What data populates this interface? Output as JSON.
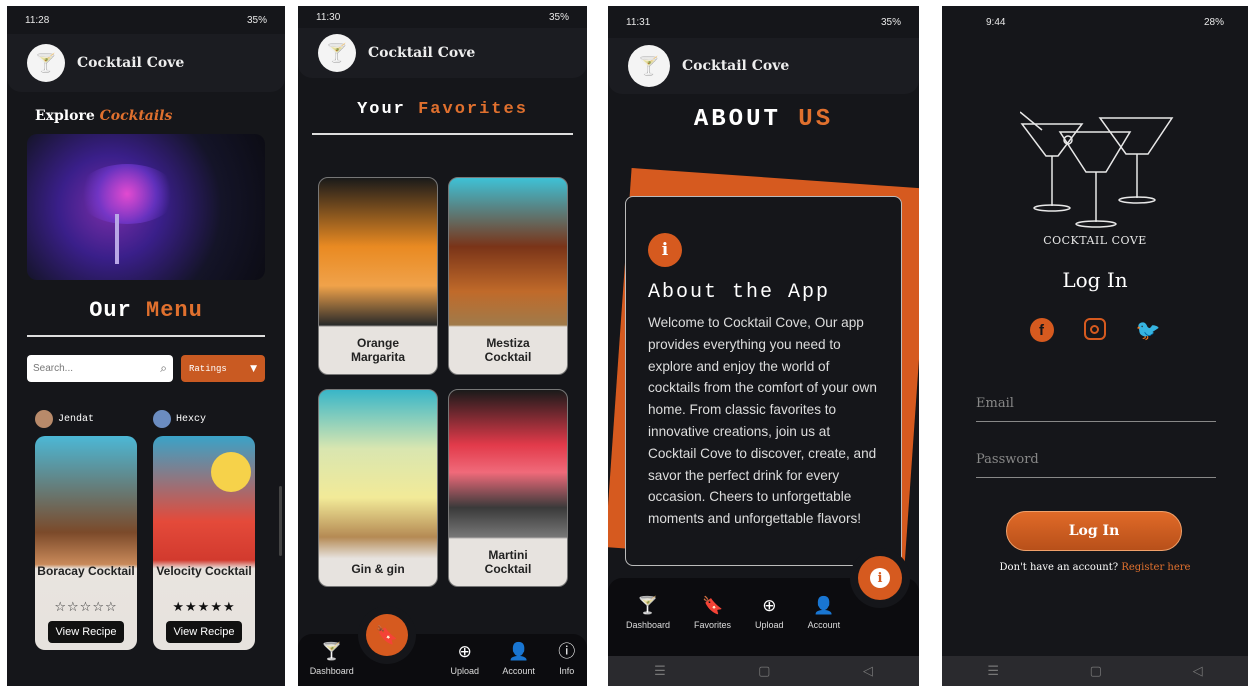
{
  "screen1": {
    "status_time": "11:28",
    "status_right": "35%",
    "app_title": "Cocktail Cove",
    "explore_label": "Explore",
    "explore_accent": "Cocktails",
    "menu_word1": "Our",
    "menu_word2": "Menu",
    "search_placeholder": "Search...",
    "ratings_label": "Ratings",
    "cards": [
      {
        "user": "Jendat",
        "name": "Boracay Cocktail",
        "stars": "☆☆☆☆☆",
        "button": "View Recipe"
      },
      {
        "user": "Hexcy",
        "name": "Velocity Cocktail",
        "stars": "★★★★★",
        "button": "View Recipe"
      }
    ]
  },
  "screen2": {
    "status_time": "11:30",
    "status_right": "35%",
    "app_title": "Cocktail Cove",
    "heading1": "Your",
    "heading2": "Favorites",
    "favorites": [
      "Orange Margarita",
      "Mestiza Cocktail",
      "Gin & gin",
      "Martini Cocktail"
    ],
    "nav": [
      "Dashboard",
      "Upload",
      "Account",
      "Info"
    ]
  },
  "screen3": {
    "status_time": "11:31",
    "status_right": "35%",
    "app_title": "Cocktail Cove",
    "heading1": "ABOUT",
    "heading2": "US",
    "about_title": "About the App",
    "about_text": "Welcome to Cocktail Cove, Our app provides everything you need to explore and enjoy the world of cocktails from the comfort of your own home. From classic favorites to innovative creations, join us at Cocktail Cove to discover, create, and savor the perfect drink for every occasion. Cheers to unforgettable moments and unforgettable flavors!",
    "nav": [
      "Dashboard",
      "Favorites",
      "Upload",
      "Account"
    ]
  },
  "screen4": {
    "status_time": "9:44",
    "status_right": "28%",
    "brand": "COCKTAIL COVE",
    "title": "Log In",
    "email_placeholder": "Email",
    "password_placeholder": "Password",
    "login_button": "Log In",
    "no_account": "Don't have an account?",
    "register_link": "Register here"
  },
  "colors": {
    "accent": "#e0702e",
    "background": "#15161a"
  }
}
